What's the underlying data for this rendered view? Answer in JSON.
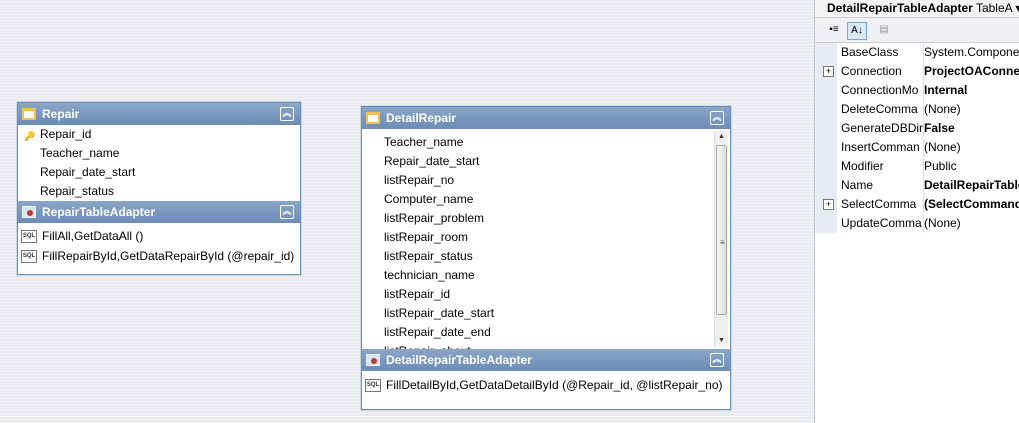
{
  "repair_table": {
    "title": "Repair",
    "columns": [
      "Repair_id",
      "Teacher_name",
      "Repair_date_start",
      "Repair_status"
    ],
    "adapter_title": "RepairTableAdapter",
    "methods": [
      "FillAll,GetDataAll ()",
      "FillRepairById,GetDataRepairById (@repair_id)"
    ]
  },
  "detail_table": {
    "title": "DetailRepair",
    "columns": [
      "Teacher_name",
      "Repair_date_start",
      "listRepair_no",
      "Computer_name",
      "listRepair_problem",
      "listRepair_room",
      "listRepair_status",
      "technician_name",
      "listRepair_id",
      "listRepair_date_start",
      "listRepair_date_end",
      "listRepair_about"
    ],
    "adapter_title": "DetailRepairTableAdapter",
    "methods": [
      "FillDetailById,GetDataDetailById (@Repair_id, @listRepair_no)"
    ]
  },
  "properties": {
    "object_name": "DetailRepairTableAdapter",
    "object_type": "TableA",
    "rows": [
      {
        "name": "BaseClass",
        "value": "System.Componen",
        "bold": false,
        "expandable": false
      },
      {
        "name": "Connection",
        "value": "ProjectOAConnec",
        "bold": true,
        "expandable": true
      },
      {
        "name": "ConnectionMo",
        "value": "Internal",
        "bold": true,
        "expandable": false
      },
      {
        "name": "DeleteComma",
        "value": "(None)",
        "bold": false,
        "expandable": false
      },
      {
        "name": "GenerateDBDir",
        "value": "False",
        "bold": true,
        "expandable": false
      },
      {
        "name": "InsertComman",
        "value": "(None)",
        "bold": false,
        "expandable": false
      },
      {
        "name": "Modifier",
        "value": "Public",
        "bold": false,
        "expandable": false
      },
      {
        "name": "Name",
        "value": "DetailRepairTable",
        "bold": true,
        "expandable": false
      },
      {
        "name": "SelectComma",
        "value": "(SelectCommand)",
        "bold": true,
        "expandable": true
      },
      {
        "name": "UpdateComma",
        "value": "(None)",
        "bold": false,
        "expandable": false
      }
    ]
  }
}
